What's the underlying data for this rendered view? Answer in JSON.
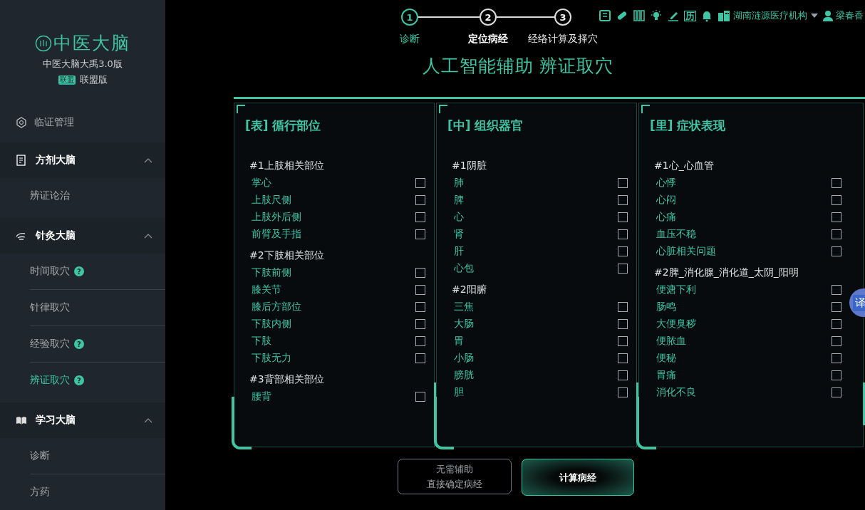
{
  "sidebar": {
    "logo": {
      "title": "中医大脑",
      "subtitle": "中医大脑大禹3.0版",
      "edition_badge": "联盟",
      "edition": "联盟版"
    },
    "top_item": {
      "label": "临证管理"
    },
    "groups": [
      {
        "label": "方剂大脑",
        "expanded": true,
        "items": [
          {
            "label": "辨证论治",
            "selected": false
          }
        ]
      },
      {
        "label": "针灸大脑",
        "expanded": true,
        "items": [
          {
            "label": "时间取穴",
            "badge": "?",
            "selected": false
          },
          {
            "label": "针律取穴",
            "selected": false
          },
          {
            "label": "经验取穴",
            "badge": "?",
            "selected": false
          },
          {
            "label": "辨证取穴",
            "badge": "?",
            "selected": true
          }
        ]
      },
      {
        "label": "学习大脑",
        "expanded": true,
        "items": [
          {
            "label": "诊断",
            "selected": false
          },
          {
            "label": "方药",
            "selected": false
          }
        ]
      }
    ]
  },
  "steps": [
    {
      "number": "1",
      "label": "诊断",
      "completed": true,
      "selected": false
    },
    {
      "number": "2",
      "label": "定位病经",
      "completed": false,
      "selected": true
    },
    {
      "number": "3",
      "label": "经络计算及择穴",
      "completed": false,
      "selected": false
    }
  ],
  "toolbar": {
    "icons": [
      {
        "kind": "card"
      },
      {
        "kind": "pill"
      },
      {
        "kind": "books"
      },
      {
        "kind": "bulb"
      },
      {
        "kind": "pen"
      },
      {
        "kind": "glyph",
        "text": "历"
      },
      {
        "kind": "bell"
      }
    ],
    "organization": "湖南涟源医疗机构",
    "user": "梁春香"
  },
  "title": "人工智能辅助 辨证取穴",
  "panels": [
    {
      "tag": "[表]",
      "heading": "循行部位",
      "groups": [
        {
          "label": "#1上肢相关部位",
          "items": [
            {
              "label": "掌心",
              "checked": false
            },
            {
              "label": "上肢尺侧",
              "checked": false
            },
            {
              "label": "上肢外后侧",
              "checked": false
            },
            {
              "label": "前臂及手指",
              "checked": false
            }
          ]
        },
        {
          "label": "#2下肢相关部位",
          "items": [
            {
              "label": "下肢前侧",
              "checked": false
            },
            {
              "label": "膝关节",
              "checked": false
            },
            {
              "label": "膝后方部位",
              "checked": false
            },
            {
              "label": "下肢内侧",
              "checked": false
            },
            {
              "label": "下肢",
              "checked": false
            },
            {
              "label": "下肢无力",
              "checked": false
            }
          ]
        },
        {
          "label": "#3背部相关部位",
          "items": [
            {
              "label": "腰背",
              "checked": false
            }
          ]
        }
      ]
    },
    {
      "tag": "[中]",
      "heading": "组织器官",
      "groups": [
        {
          "label": "#1阴脏",
          "items": [
            {
              "label": "肺",
              "checked": false
            },
            {
              "label": "脾",
              "checked": false
            },
            {
              "label": "心",
              "checked": false
            },
            {
              "label": "肾",
              "checked": false
            },
            {
              "label": "肝",
              "checked": false
            },
            {
              "label": "心包",
              "checked": false
            }
          ]
        },
        {
          "label": "#2阳腑",
          "items": [
            {
              "label": "三焦",
              "checked": false
            },
            {
              "label": "大肠",
              "checked": false
            },
            {
              "label": "胃",
              "checked": false
            },
            {
              "label": "小肠",
              "checked": false
            },
            {
              "label": "膀胱",
              "checked": false
            },
            {
              "label": "胆",
              "checked": false
            }
          ]
        }
      ]
    },
    {
      "tag": "[里]",
      "heading": "症状表现",
      "groups": [
        {
          "label": "#1心_心血管",
          "items": [
            {
              "label": "心悸",
              "checked": false
            },
            {
              "label": "心闷",
              "checked": false
            },
            {
              "label": "心痛",
              "checked": false
            },
            {
              "label": "血压不稳",
              "checked": false
            },
            {
              "label": "心脏相关问题",
              "checked": false
            }
          ]
        },
        {
          "label": "#2脾_消化腺_消化道_太阴_阳明",
          "items": [
            {
              "label": "便溏下利",
              "checked": false
            },
            {
              "label": "肠鸣",
              "checked": false
            },
            {
              "label": "大便臭秽",
              "checked": false
            },
            {
              "label": "便脓血",
              "checked": false
            },
            {
              "label": "便秘",
              "checked": false
            },
            {
              "label": "胃痛",
              "checked": false
            },
            {
              "label": "消化不良",
              "checked": false
            }
          ]
        }
      ]
    }
  ],
  "actions": [
    {
      "kind": "outline",
      "lines": [
        "无需辅助",
        "直接确定病经"
      ]
    },
    {
      "kind": "primary",
      "lines": [
        "计算病经"
      ]
    }
  ],
  "translate_button": "译"
}
